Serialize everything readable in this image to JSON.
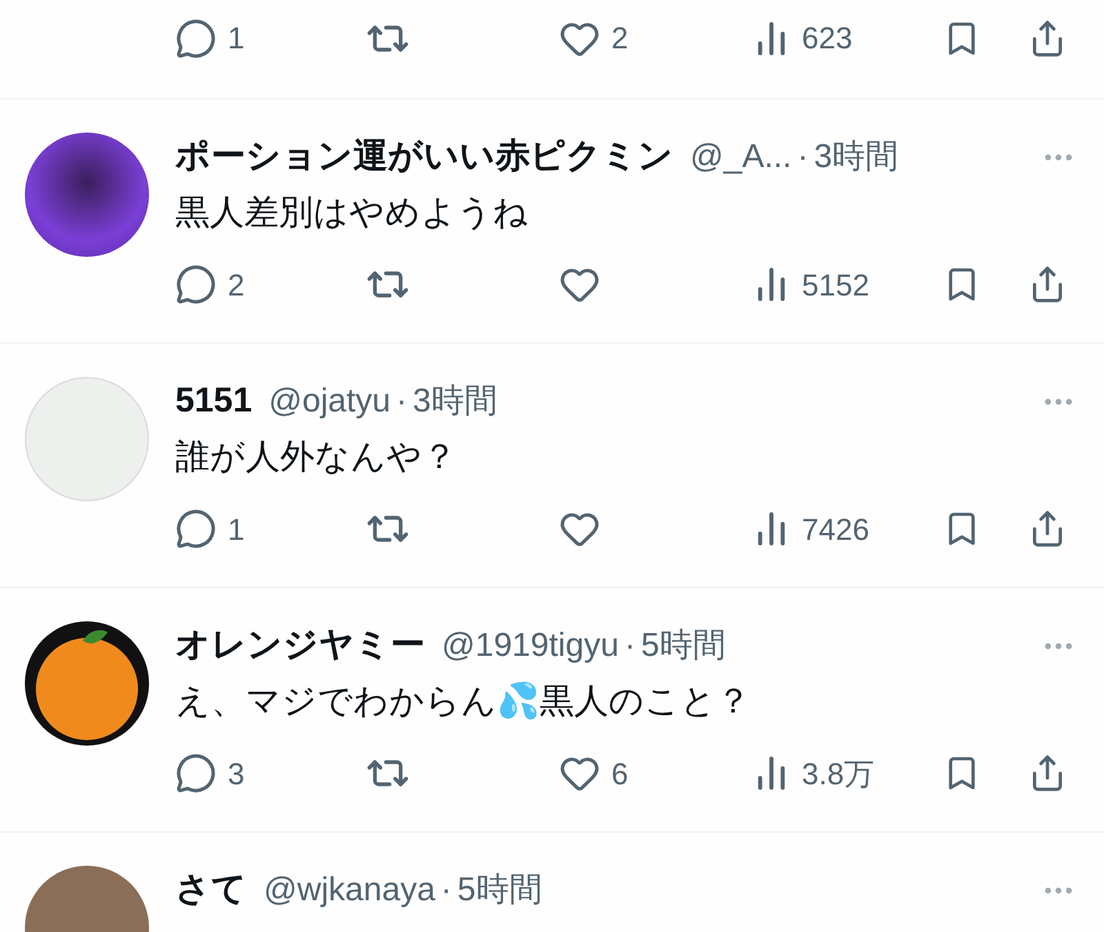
{
  "top_actions": {
    "replies": "1",
    "likes": "2",
    "views": "623"
  },
  "replies": [
    {
      "kind": "purple",
      "name": "ポーション運がいい赤ピクミン",
      "handle": "@_A...",
      "separator": "·",
      "time": "3時間",
      "text": "黒人差別はやめようね",
      "replies": "2",
      "views": "5152"
    },
    {
      "kind": "sketch",
      "name": "5151",
      "handle": "@ojatyu",
      "separator": "·",
      "time": "3時間",
      "text": "誰が人外なんや？",
      "replies": "1",
      "views": "7426"
    },
    {
      "kind": "fruit",
      "name": "オレンジヤミー",
      "handle": "@1919tigyu",
      "separator": "·",
      "time": "5時間",
      "text": "え、マジでわからん💦黒人のこと？",
      "replies": "3",
      "likes": "6",
      "views": "3.8万"
    },
    {
      "kind": "photo",
      "name": "さて",
      "handle": "@wjkanaya",
      "separator": "·",
      "time": "5時間"
    }
  ]
}
